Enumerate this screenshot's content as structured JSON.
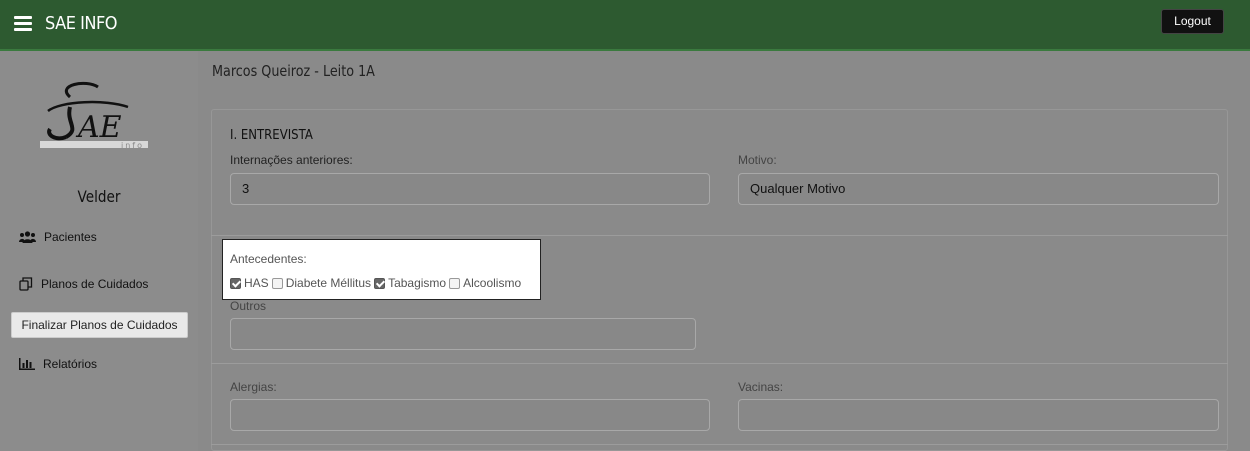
{
  "app": {
    "brand": "SAE INFO",
    "logout_label": "Logout"
  },
  "sidebar": {
    "user_name": "Velder",
    "items": [
      {
        "label": "Pacientes",
        "icon": "users-icon"
      },
      {
        "label": "Planos de Cuidados",
        "icon": "copy-icon"
      },
      {
        "label": "Finalizar Planos de Cuidados",
        "icon": ""
      },
      {
        "label": "Relatórios",
        "icon": "bar-chart-icon"
      }
    ]
  },
  "logo": {
    "text": "SAE",
    "subtext": "info"
  },
  "page": {
    "title": "Marcos Queiroz - Leito 1A"
  },
  "form": {
    "section_title": "I. ENTREVISTA",
    "internacoes": {
      "label": "Internações anteriores:",
      "value": "3"
    },
    "motivo": {
      "label": "Motivo:",
      "value": "Qualquer Motivo"
    },
    "antecedentes": {
      "label": "Antecedentes:",
      "options": [
        {
          "label": "HAS",
          "checked": true
        },
        {
          "label": "Diabete Méllitus",
          "checked": false
        },
        {
          "label": "Tabagismo",
          "checked": true
        },
        {
          "label": "Alcoolismo",
          "checked": false
        }
      ]
    },
    "outros": {
      "label": "Outros",
      "value": ""
    },
    "alergias": {
      "label": "Alergias:",
      "value": ""
    },
    "vacinas": {
      "label": "Vacinas:",
      "value": ""
    }
  },
  "colors": {
    "header": "#2d5a30",
    "overlay": "#8a8a8a",
    "highlight_bg": "#ffffff"
  }
}
